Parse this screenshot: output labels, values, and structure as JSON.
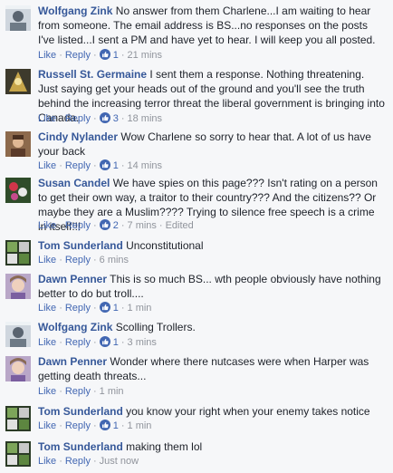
{
  "colors": {
    "name": "#365899",
    "link": "#4267b2",
    "meta": "#90949c",
    "text": "#1d2129"
  },
  "labels": {
    "like": "Like",
    "reply": "Reply",
    "separator": "·",
    "like_icon": "thumbs-up-icon"
  },
  "comments": [
    {
      "author": "Wolfgang Zink",
      "text": "No answer from them Charlene...I am waiting to hear from someone. The email address is BS...no responses on the posts I've listed...I sent a PM and have yet to hear. I will keep you all posted.",
      "likes": "1",
      "time": "21 mins",
      "edited": ""
    },
    {
      "author": "Russell St. Germaine",
      "text": "I sent them a response. Nothing threatening. Just saying get your heads out of the ground and you'll see the truth behind the increasing terror threat the liberal government is bringing into Canada.",
      "likes": "3",
      "time": "18 mins",
      "edited": ""
    },
    {
      "author": "Cindy Nylander",
      "text": "Wow Charlene so sorry to hear that. A lot of us have your back",
      "likes": "1",
      "time": "14 mins",
      "edited": ""
    },
    {
      "author": "Susan Candel",
      "text": "We have spies on this page??? Isn't rating on a person to get their own way, a traitor to their country??? And the citizens?? Or maybe they are a Muslim???? Trying to silence free speech is a crime in itself!!!",
      "likes": "2",
      "time": "7 mins",
      "edited": "Edited"
    },
    {
      "author": "Tom Sunderland",
      "text": "Unconstitutional",
      "likes": "",
      "time": "6 mins",
      "edited": ""
    },
    {
      "author": "Dawn Penner",
      "text": "This is so much BS... wth people obviously have nothing better to do but troll....",
      "likes": "1",
      "time": "1 min",
      "edited": ""
    },
    {
      "author": "Wolfgang Zink",
      "text": "Scolling Trollers.",
      "likes": "1",
      "time": "3 mins",
      "edited": ""
    },
    {
      "author": "Dawn Penner",
      "text": "Wonder where there nutcases were when Harper was getting death threats...",
      "likes": "",
      "time": "1 min",
      "edited": ""
    },
    {
      "author": "Tom Sunderland",
      "text": "you know your right when your enemy takes notice",
      "likes": "1",
      "time": "1 min",
      "edited": ""
    },
    {
      "author": "Tom Sunderland",
      "text": "making them lol",
      "likes": "",
      "time": "Just now",
      "edited": ""
    }
  ]
}
